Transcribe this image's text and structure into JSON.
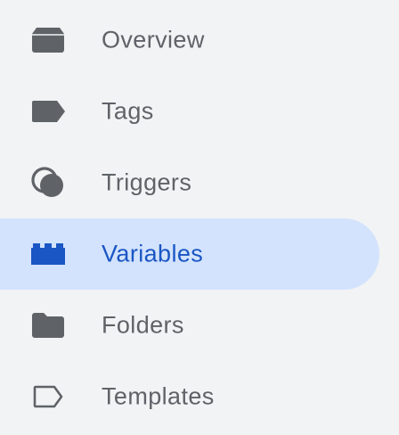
{
  "colors": {
    "background": "#f1f3f4",
    "text": "#5f6368",
    "icon": "#5f6368",
    "active_background": "#d3e3fd",
    "active_text": "#1a56c4",
    "active_icon": "#1a56c4"
  },
  "sidebar": {
    "items": [
      {
        "label": "Overview",
        "icon": "overview-icon",
        "active": false
      },
      {
        "label": "Tags",
        "icon": "tag-icon",
        "active": false
      },
      {
        "label": "Triggers",
        "icon": "trigger-icon",
        "active": false
      },
      {
        "label": "Variables",
        "icon": "variables-icon",
        "active": true
      },
      {
        "label": "Folders",
        "icon": "folder-icon",
        "active": false
      },
      {
        "label": "Templates",
        "icon": "template-icon",
        "active": false
      }
    ]
  }
}
